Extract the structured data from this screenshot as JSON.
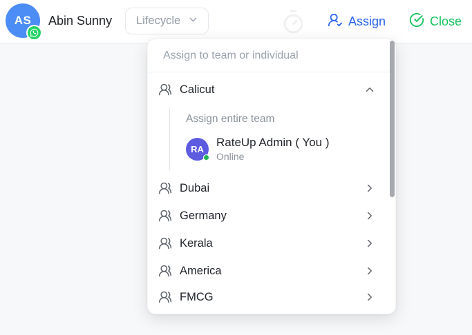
{
  "header": {
    "contact_initials": "AS",
    "contact_name": "Abin Sunny",
    "lifecycle_label": "Lifecycle",
    "assign_label": "Assign",
    "close_label": "Close"
  },
  "assign_dropdown": {
    "search_placeholder": "Assign to team or individual",
    "expanded_team": {
      "name": "Calicut",
      "assign_entire_team_label": "Assign entire team",
      "member": {
        "initials": "RA",
        "name": "RateUp Admin ( You )",
        "status": "Online"
      }
    },
    "collapsed_teams": [
      "Dubai",
      "Germany",
      "Kerala",
      "America",
      "FMCG"
    ]
  },
  "icons": {
    "avatar_badge": "whatsapp-icon",
    "lifecycle": "chevron-down-icon",
    "header_faded": "timer-icon",
    "assign": "user-check-icon",
    "close": "check-circle-icon",
    "team": "users-icon",
    "expanded": "chevron-up-icon",
    "collapsed": "chevron-right-icon"
  },
  "colors": {
    "avatar_blue": "#4C8DF5",
    "whatsapp_green": "#25D366",
    "assign_blue": "#2A66EC",
    "close_green": "#13C35E",
    "member_avatar_purple": "#5D5BE0",
    "online_dot_green": "#22B358"
  }
}
